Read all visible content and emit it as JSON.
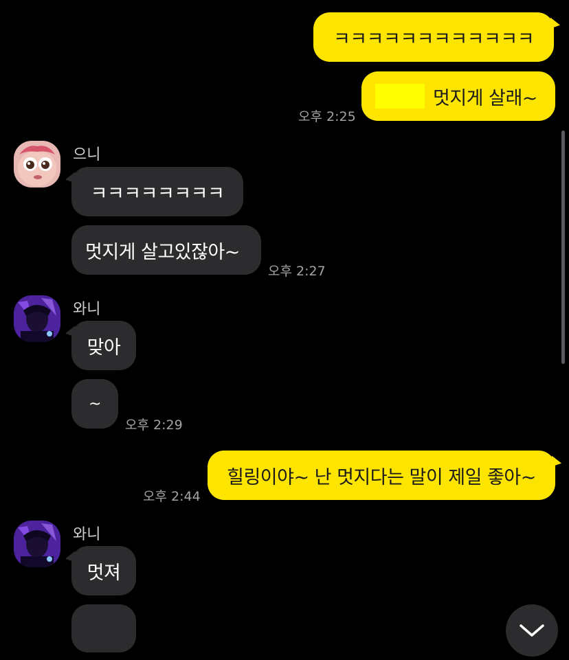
{
  "messages": {
    "m1": {
      "text": "ㅋㅋㅋㅋㅋㅋㅋㅋㅋㅋㅋㅋ"
    },
    "m2": {
      "text": "멋지게 살래~",
      "time": "오후 2:25"
    },
    "m3": {
      "sender": "으니",
      "text": "ㅋㅋㅋㅋㅋㅋㅋㅋ"
    },
    "m4": {
      "text": "멋지게 살고있잖아~",
      "time": "오후 2:27"
    },
    "m5": {
      "sender": "와니",
      "text": "맞아"
    },
    "m6": {
      "text": "~",
      "time": "오후 2:29"
    },
    "m7": {
      "text": "힐링이야~ 난 멋지다는 말이 제일 좋아~",
      "time": "오후 2:44"
    },
    "m8": {
      "sender": "와니",
      "text": "멋져"
    },
    "m9": {
      "text": ""
    }
  },
  "icons": {
    "scroll_down": "chevron-down-icon"
  },
  "colors": {
    "background": "#000000",
    "my_bubble": "#FEE500",
    "other_bubble": "#2c2c2e",
    "timestamp": "#a4a4a8",
    "redaction": "#FFFF00"
  }
}
